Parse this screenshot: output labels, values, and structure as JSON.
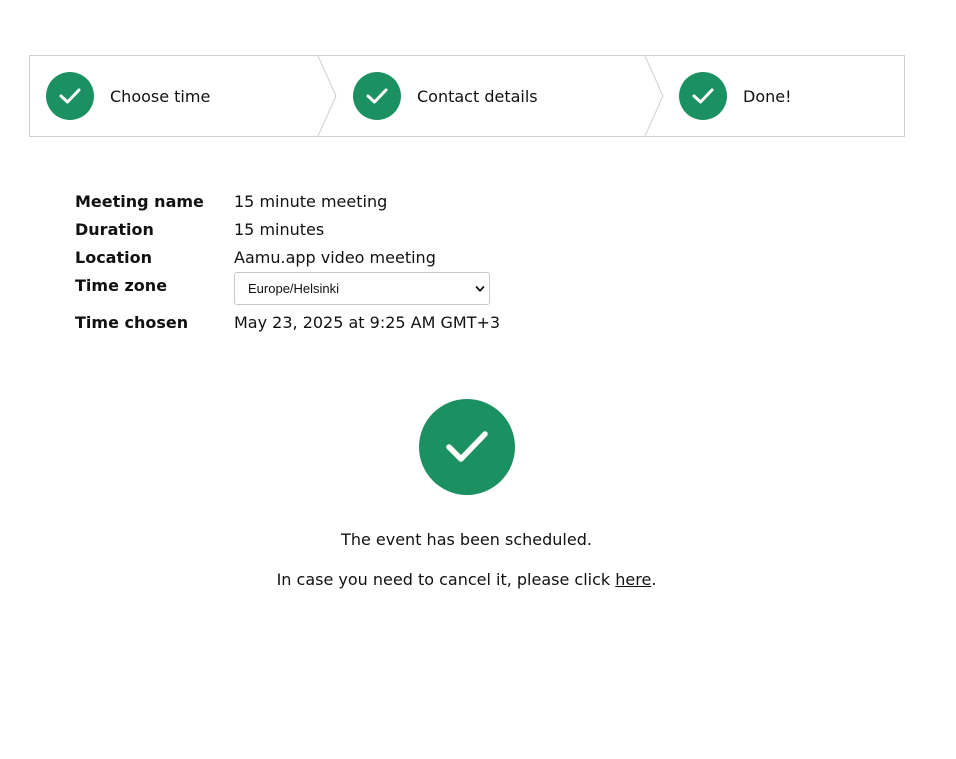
{
  "colors": {
    "accent": "#1b9162",
    "border": "#cfcfcf"
  },
  "steps": [
    {
      "label": "Choose time",
      "icon": "check-icon",
      "status": "complete"
    },
    {
      "label": "Contact details",
      "icon": "check-icon",
      "status": "complete"
    },
    {
      "label": "Done!",
      "icon": "check-icon",
      "status": "complete"
    }
  ],
  "details": {
    "meeting_name_label": "Meeting name",
    "meeting_name_value": "15 minute meeting",
    "duration_label": "Duration",
    "duration_value": "15 minutes",
    "location_label": "Location",
    "location_value": "Aamu.app video meeting",
    "timezone_label": "Time zone",
    "timezone_value": "Europe/Helsinki",
    "time_chosen_label": "Time chosen",
    "time_chosen_value": "May 23, 2025 at 9:25 AM GMT+3"
  },
  "confirmation": {
    "icon": "check-circle-icon",
    "message": "The event has been scheduled.",
    "cancel_prefix": "In case you need to cancel it, please click ",
    "cancel_link": "here",
    "cancel_suffix": "."
  }
}
